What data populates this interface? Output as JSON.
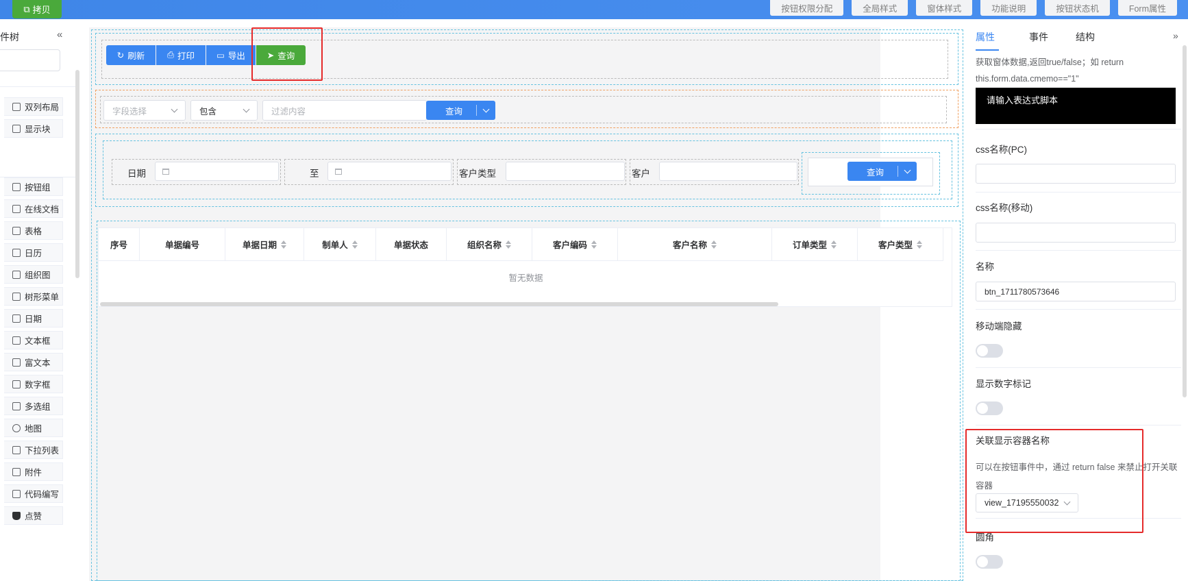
{
  "topbar": {
    "copy_label": "拷贝",
    "actions": [
      "按钮权限分配",
      "全局样式",
      "窗体样式",
      "功能说明",
      "按钮状态机",
      "Form属性"
    ]
  },
  "left": {
    "title": "件树",
    "collapse_icon": "«",
    "components": [
      {
        "label": "双列布局",
        "icon": "grid-icon"
      },
      {
        "label": "显示块",
        "icon": "block-icon"
      },
      {
        "label": "按钮组",
        "icon": "button-group-icon"
      },
      {
        "label": "在线文档",
        "icon": "document-icon"
      },
      {
        "label": "表格",
        "icon": "table-icon"
      },
      {
        "label": "日历",
        "icon": "calendar-icon"
      },
      {
        "label": "组织图",
        "icon": "org-chart-icon"
      },
      {
        "label": "树形菜单",
        "icon": "tree-menu-icon"
      },
      {
        "label": "日期",
        "icon": "date-icon"
      },
      {
        "label": "文本框",
        "icon": "textbox-icon"
      },
      {
        "label": "富文本",
        "icon": "rich-text-icon"
      },
      {
        "label": "数字框",
        "icon": "number-box-icon"
      },
      {
        "label": "多选组",
        "icon": "checkbox-group-icon"
      },
      {
        "label": "地图",
        "icon": "map-icon"
      },
      {
        "label": "下拉列表",
        "icon": "dropdown-icon"
      },
      {
        "label": "附件",
        "icon": "attachment-icon"
      },
      {
        "label": "代码编写",
        "icon": "code-icon"
      },
      {
        "label": "点赞",
        "icon": "thumbs-up-icon"
      }
    ]
  },
  "toolbar": {
    "refresh": "刷新",
    "print": "打印",
    "export": "导出",
    "query": "查询"
  },
  "filter": {
    "field_placeholder": "字段选择",
    "operator": "包含",
    "content_placeholder": "过滤内容",
    "query": "查询"
  },
  "search_form": {
    "date_label": "日期",
    "to_label": "至",
    "customer_type_label": "客户类型",
    "customer_label": "客户",
    "query": "查询"
  },
  "table": {
    "columns": [
      "序号",
      "单据编号",
      "单据日期",
      "制单人",
      "单据状态",
      "组织名称",
      "客户编码",
      "客户名称",
      "订单类型",
      "客户类型"
    ],
    "empty_text": "暂无数据"
  },
  "right": {
    "tabs": [
      "属性",
      "事件",
      "结构"
    ],
    "expand_icon": "»",
    "desc_line1": "获取窗体数据,返回true/false；如 return",
    "desc_line2": "this.form.data.cmemo==\"1\"",
    "code_placeholder": "请输入表达式脚本",
    "css_pc_label": "css名称(PC)",
    "css_mobile_label": "css名称(移动)",
    "name_label": "名称",
    "name_value": "btn_1711780573646",
    "mobile_hide_label": "移动端隐藏",
    "show_number_label": "显示数字标记",
    "linked_container_label": "关联显示容器名称",
    "linked_desc_line1": "可以在按钮事件中，通过 return false 来禁止打开关联",
    "linked_desc_line2": "容器",
    "linked_value": "view_17195550032",
    "rounded_label": "圆角"
  },
  "colors": {
    "primary": "#3a86f1",
    "success": "#4aa93b",
    "highlight": "#e52a2a"
  }
}
